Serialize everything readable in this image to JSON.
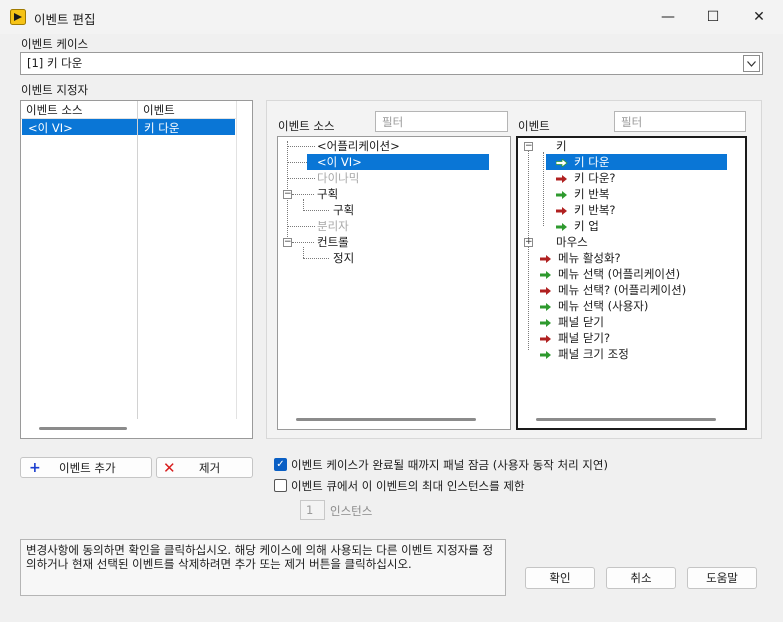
{
  "window": {
    "title": "이벤트 편집",
    "minimize_glyph": "—",
    "maximize_glyph": "☐",
    "close_glyph": "✕"
  },
  "event_cases": {
    "label": "이벤트 케이스",
    "value": "[1] 키 다운"
  },
  "specifiers": {
    "label": "이벤트 지정자",
    "col_source": "이벤트 소스",
    "col_event": "이벤트",
    "rows": [
      {
        "source": "<이 VI>",
        "event": "키 다운"
      }
    ]
  },
  "sources": {
    "label": "이벤트 소스",
    "filter_placeholder": "필터",
    "items": [
      {
        "text": "<어플리케이션>"
      },
      {
        "text": "<이 VI>"
      },
      {
        "text": "다이나믹"
      },
      {
        "text": "구획"
      },
      {
        "text": "구획"
      },
      {
        "text": "분리자"
      },
      {
        "text": "컨트롤"
      },
      {
        "text": "정지"
      }
    ]
  },
  "events": {
    "label": "이벤트",
    "filter_placeholder": "필터",
    "items": [
      {
        "text": "키"
      },
      {
        "text": "키 다운"
      },
      {
        "text": "키 다운?"
      },
      {
        "text": "키 반복"
      },
      {
        "text": "키 반복?"
      },
      {
        "text": "키 업"
      },
      {
        "text": "마우스"
      },
      {
        "text": "메뉴 활성화?"
      },
      {
        "text": "메뉴 선택 (어플리케이션)"
      },
      {
        "text": "메뉴 선택? (어플리케이션)"
      },
      {
        "text": "메뉴 선택 (사용자)"
      },
      {
        "text": "패널 닫기"
      },
      {
        "text": "패널 닫기?"
      },
      {
        "text": "패널 크기 조정"
      }
    ]
  },
  "buttons": {
    "add_event": "이벤트 추가",
    "remove": "제거",
    "ok": "확인",
    "cancel": "취소",
    "help": "도움말"
  },
  "options": {
    "lock_panel": "이벤트 케이스가 완료될 때까지 패널 잠금 (사용자 동작 처리 지연)",
    "lock_panel_checked": true,
    "limit_instances": "이벤트 큐에서 이 이벤트의 최대 인스턴스를 제한",
    "limit_instances_checked": false,
    "instances_value": "1",
    "instances_label": "인스턴스"
  },
  "message": "변경사항에 동의하면 확인을 클릭하십시오.  해당 케이스에 의해 사용되는 다른 이벤트 지정자를 정의하거나 현재 선택된 이벤트를 삭제하려면 추가 또는 제거 버튼을 클릭하십시오.",
  "colors": {
    "selection": "#0a76d6",
    "notify_arrow": "#2e9a2e",
    "filter_arrow": "#b02020",
    "add_plus": "#1c3fcf",
    "remove_x": "#d81e1e"
  }
}
